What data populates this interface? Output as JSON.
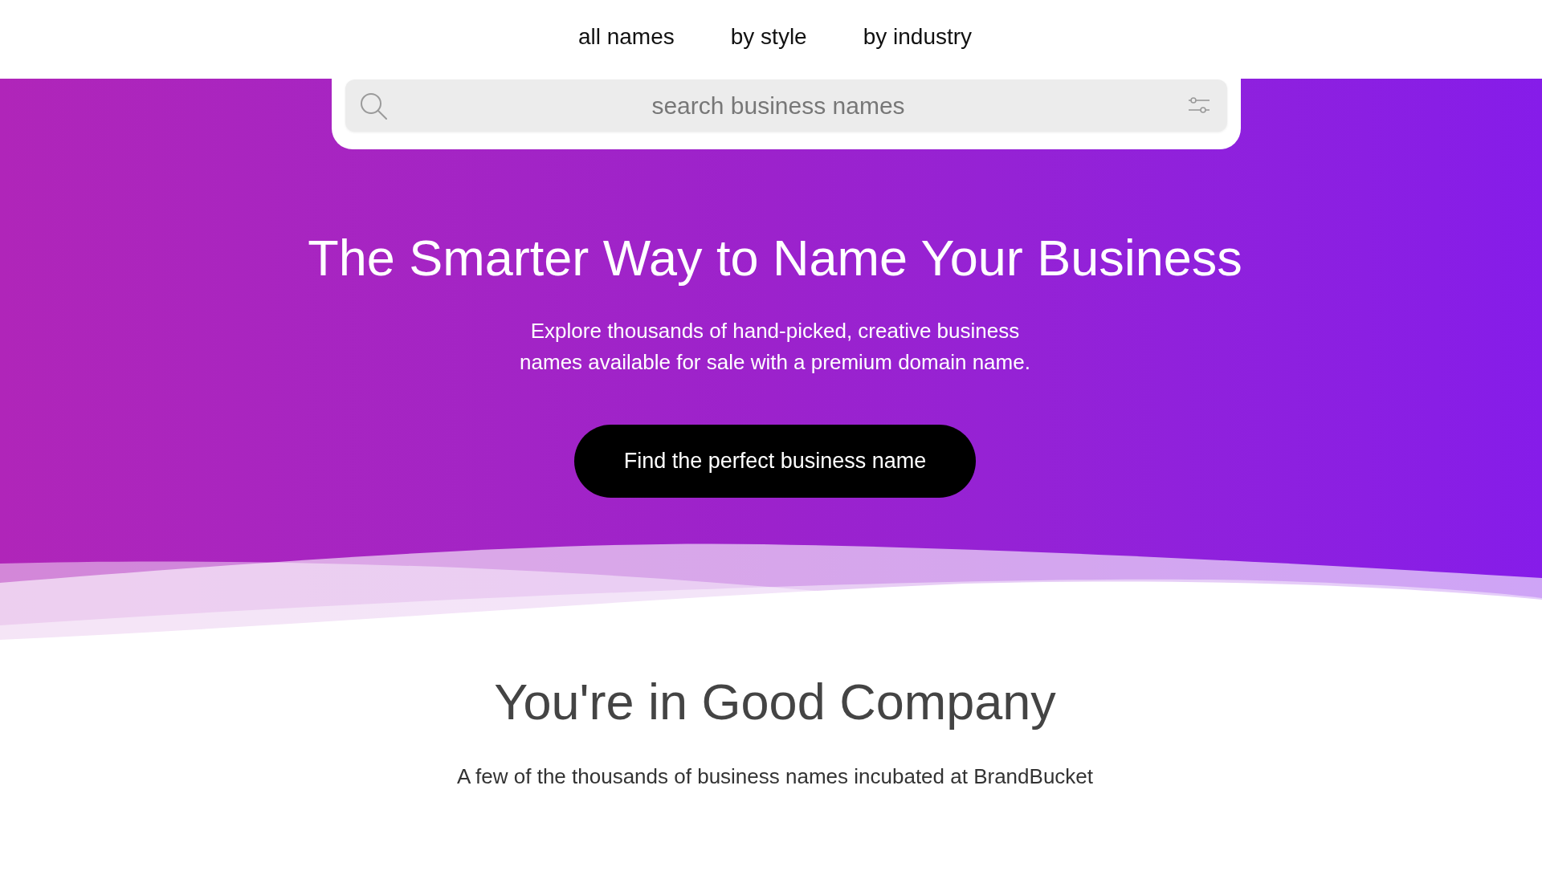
{
  "nav": {
    "links": [
      "all names",
      "by style",
      "by industry"
    ]
  },
  "search": {
    "placeholder": "search business names"
  },
  "hero": {
    "title": "The Smarter Way to Name Your Business",
    "description": "Explore thousands of hand-picked, creative business names available for sale with a premium domain name.",
    "cta": "Find the perfect business name"
  },
  "section": {
    "title": "You're in Good Company",
    "subtitle": "A few of the thousands of business names incubated at BrandBucket"
  }
}
